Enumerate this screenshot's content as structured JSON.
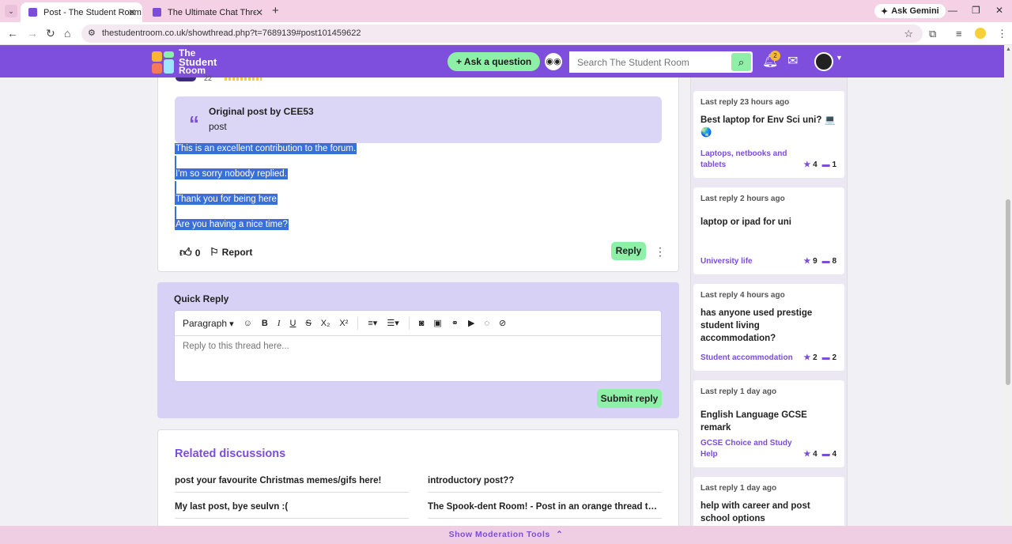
{
  "browser": {
    "tabs": [
      {
        "title": "Post - The Student Room"
      },
      {
        "title": "The Ultimate Chat Thread! - The"
      }
    ],
    "ask_gemini": "Ask Gemini",
    "url": "thestudentroom.co.uk/showthread.php?t=7689139#post101459622"
  },
  "header": {
    "logo_text": [
      "The",
      "Student",
      "Room"
    ],
    "ask_button": "+ Ask a question",
    "search_placeholder": "Search The Student Room",
    "notifications_count": "2"
  },
  "post": {
    "rating_partial": "22",
    "quote_author": "Original post by CEE53",
    "quote_body": "post",
    "lines": [
      "This is an excellent contribution to the forum.",
      "I'm so sorry nobody replied.",
      "Thank you for being here",
      "Are you having a nice time?"
    ],
    "like_count": "0",
    "report_label": "Report",
    "reply_label": "Reply"
  },
  "quick_reply": {
    "title": "Quick Reply",
    "paragraph_label": "Paragraph",
    "placeholder": "Reply to this thread here...",
    "submit_label": "Submit reply"
  },
  "related": {
    "title": "Related discussions",
    "items": [
      "post your favourite Christmas memes/gifs here!",
      "introductory post??",
      "My last post, bye seulvn :(",
      "The Spook-dent Room! - Post in an orange thread to win..."
    ]
  },
  "sidebar": {
    "cards": [
      {
        "when": "Last reply 23 hours ago",
        "title": "Best laptop for Env Sci uni? 💻🌏",
        "category": "Laptops, netbooks and tablets",
        "stars": "4",
        "comments": "1"
      },
      {
        "when": "Last reply 2 hours ago",
        "title": "laptop or ipad for uni",
        "category": "University life",
        "stars": "9",
        "comments": "8"
      },
      {
        "when": "Last reply 4 hours ago",
        "title": "has anyone used prestige student living accommodation?",
        "category": "Student accommodation",
        "stars": "2",
        "comments": "2"
      },
      {
        "when": "Last reply 1 day ago",
        "title": "English Language GCSE remark",
        "category": "GCSE Choice and Study Help",
        "stars": "4",
        "comments": "4"
      },
      {
        "when": "Last reply 1 day ago",
        "title": "help with career and post school options",
        "category": "",
        "stars": "",
        "comments": ""
      }
    ]
  },
  "footer": {
    "moderation": "Show Moderation Tools"
  }
}
